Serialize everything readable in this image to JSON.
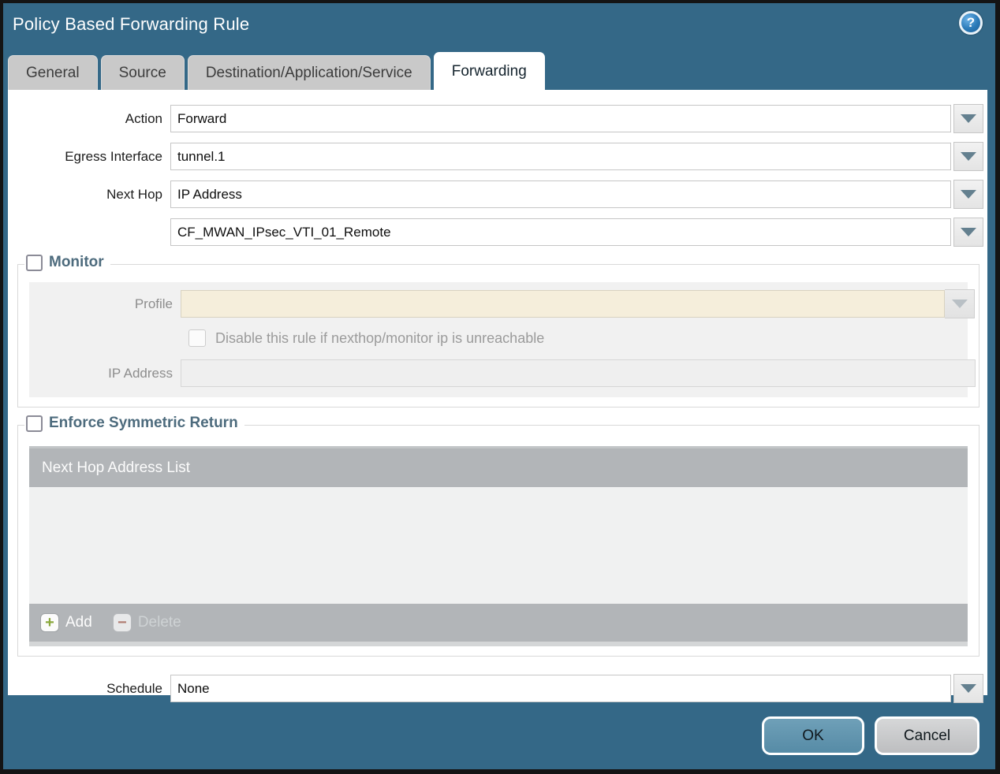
{
  "dialog": {
    "title": "Policy Based Forwarding Rule",
    "help_icon": "question-mark-circle-icon",
    "help_glyph": "?"
  },
  "tabs": [
    {
      "label": "General",
      "active": false
    },
    {
      "label": "Source",
      "active": false
    },
    {
      "label": "Destination/Application/Service",
      "active": false
    },
    {
      "label": "Forwarding",
      "active": true
    }
  ],
  "form": {
    "action": {
      "label": "Action",
      "value": "Forward"
    },
    "egress_interface": {
      "label": "Egress Interface",
      "value": "tunnel.1"
    },
    "next_hop": {
      "label": "Next Hop",
      "value": "IP Address"
    },
    "next_hop_address": {
      "value": "CF_MWAN_IPsec_VTI_01_Remote"
    },
    "schedule": {
      "label": "Schedule",
      "value": "None"
    }
  },
  "monitor": {
    "legend": "Monitor",
    "checked": false,
    "profile": {
      "label": "Profile",
      "value": ""
    },
    "disable_rule_checkbox": {
      "label": "Disable this rule if nexthop/monitor ip is unreachable",
      "checked": false
    },
    "ip_address": {
      "label": "IP Address",
      "value": ""
    }
  },
  "enforce_symmetric_return": {
    "legend": "Enforce Symmetric Return",
    "checked": false,
    "table": {
      "header": "Next Hop Address List",
      "rows": [],
      "add_label": "Add",
      "delete_label": "Delete",
      "add_icon": "plus-icon",
      "delete_icon": "minus-icon",
      "add_glyph": "+",
      "delete_glyph": "−"
    }
  },
  "footer": {
    "ok_label": "OK",
    "cancel_label": "Cancel"
  },
  "colors": {
    "titlebar_teal": "#346887",
    "active_tab_bg": "#ffffff",
    "inactive_tab_bg": "#c9c9c9",
    "table_gray": "#b2b5b8",
    "beige_field": "#f5eedb",
    "ok_button": "#5e93ad",
    "cancel_button": "#c7c9ca",
    "legend_text": "#4d6b7d",
    "add_plus_green": "#8aa83c",
    "delete_minus_red": "#b06a5a"
  }
}
